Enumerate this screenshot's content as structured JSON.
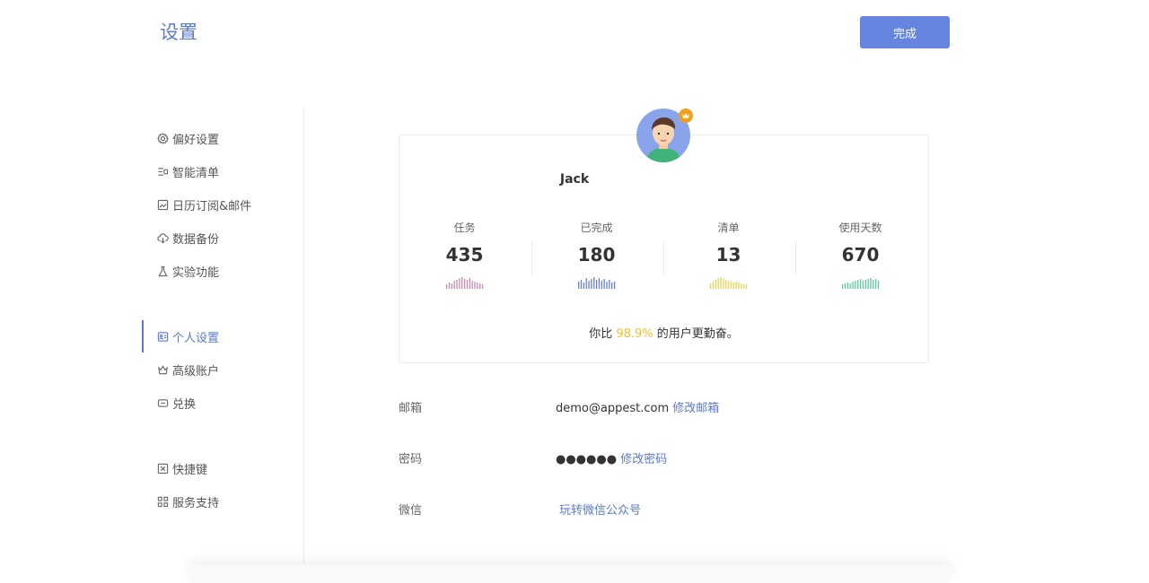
{
  "header": {
    "title": "设置",
    "done_label": "完成"
  },
  "sidebar": {
    "groups": [
      [
        {
          "label": "偏好设置",
          "icon": "gear-icon"
        },
        {
          "label": "智能清单",
          "icon": "smart-list-icon"
        },
        {
          "label": "日历订阅&邮件",
          "icon": "calendar-image-icon"
        },
        {
          "label": "数据备份",
          "icon": "cloud-download-icon"
        },
        {
          "label": "实验功能",
          "icon": "flask-icon"
        }
      ],
      [
        {
          "label": "个人设置",
          "icon": "profile-card-icon",
          "active": true
        },
        {
          "label": "高级账户",
          "icon": "crown-icon"
        },
        {
          "label": "兑换",
          "icon": "ticket-icon"
        }
      ],
      [
        {
          "label": "快捷键",
          "icon": "command-key-icon"
        },
        {
          "label": "服务支持",
          "icon": "apps-grid-icon"
        }
      ]
    ]
  },
  "profile": {
    "name": "Jack",
    "stats": [
      {
        "label": "任务",
        "value": "435",
        "color": "#c98ab5"
      },
      {
        "label": "已完成",
        "value": "180",
        "color": "#6a7fd8"
      },
      {
        "label": "清单",
        "value": "13",
        "color": "#e8d451"
      },
      {
        "label": "使用天数",
        "value": "670",
        "color": "#5cc79a"
      }
    ],
    "beat_prefix": "你比",
    "beat_percent": "98.9%",
    "beat_suffix": "的用户更勤奋。"
  },
  "account": {
    "email_label": "邮箱",
    "email_value": "demo@appest.com",
    "email_link": "修改邮箱",
    "password_label": "密码",
    "password_value": "●●●●●●",
    "password_link": "修改密码",
    "wechat_label": "微信",
    "wechat_link": "玩转微信公众号"
  },
  "colors": {
    "accent": "#5b78d6",
    "button": "#6484e0",
    "highlight": "#f3bf2f"
  }
}
